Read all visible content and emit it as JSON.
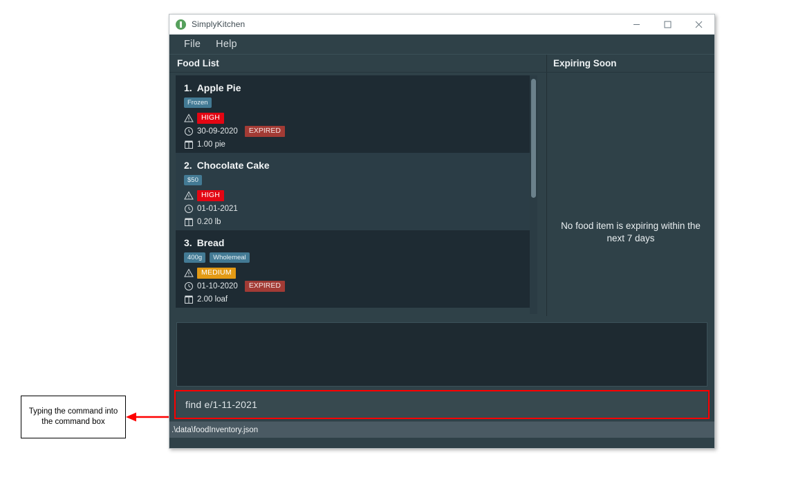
{
  "annotation": {
    "text": "Typing the command into the command box",
    "arrow_color": "#ff0000",
    "points_to": "command-box"
  },
  "window": {
    "title": "SimplyKitchen",
    "icon": "app-logo-icon",
    "controls": {
      "minimize": "minimize-icon",
      "maximize": "maximize-icon",
      "close": "close-icon"
    }
  },
  "menubar": {
    "items": [
      {
        "label": "File"
      },
      {
        "label": "Help"
      }
    ]
  },
  "panels": {
    "food_list": {
      "header": "Food List",
      "items": [
        {
          "index": "1.",
          "name": "Apple Pie",
          "tags": [
            "Frozen"
          ],
          "priority": "HIGH",
          "priority_class": "pri-high",
          "date": "30-09-2020",
          "expired": "EXPIRED",
          "quantity": "1.00 pie"
        },
        {
          "index": "2.",
          "name": "Chocolate Cake",
          "tags": [
            "$50"
          ],
          "priority": "HIGH",
          "priority_class": "pri-high",
          "date": "01-01-2021",
          "expired": "",
          "quantity": "0.20 lb"
        },
        {
          "index": "3.",
          "name": "Bread",
          "tags": [
            "400g",
            "Wholemeal"
          ],
          "priority": "MEDIUM",
          "priority_class": "pri-medium",
          "date": "01-10-2020",
          "expired": "EXPIRED",
          "quantity": "2.00 loaf"
        }
      ]
    },
    "expiring_soon": {
      "header": "Expiring Soon",
      "empty_message": "No food item is expiring within the next 7 days"
    }
  },
  "result_display": {
    "text": ""
  },
  "command": {
    "value": "find e/1-11-2021",
    "placeholder": "Enter command here..."
  },
  "status_bar": {
    "file_path": ".\\data\\foodInventory.json"
  },
  "colors": {
    "window_bg": "#2f4148",
    "tag": "#437a94",
    "priority_high": "#e30613",
    "priority_medium": "#e39a15",
    "expired": "#a23b35",
    "status_bar": "#4a5a63",
    "highlight": "#ff0000"
  }
}
